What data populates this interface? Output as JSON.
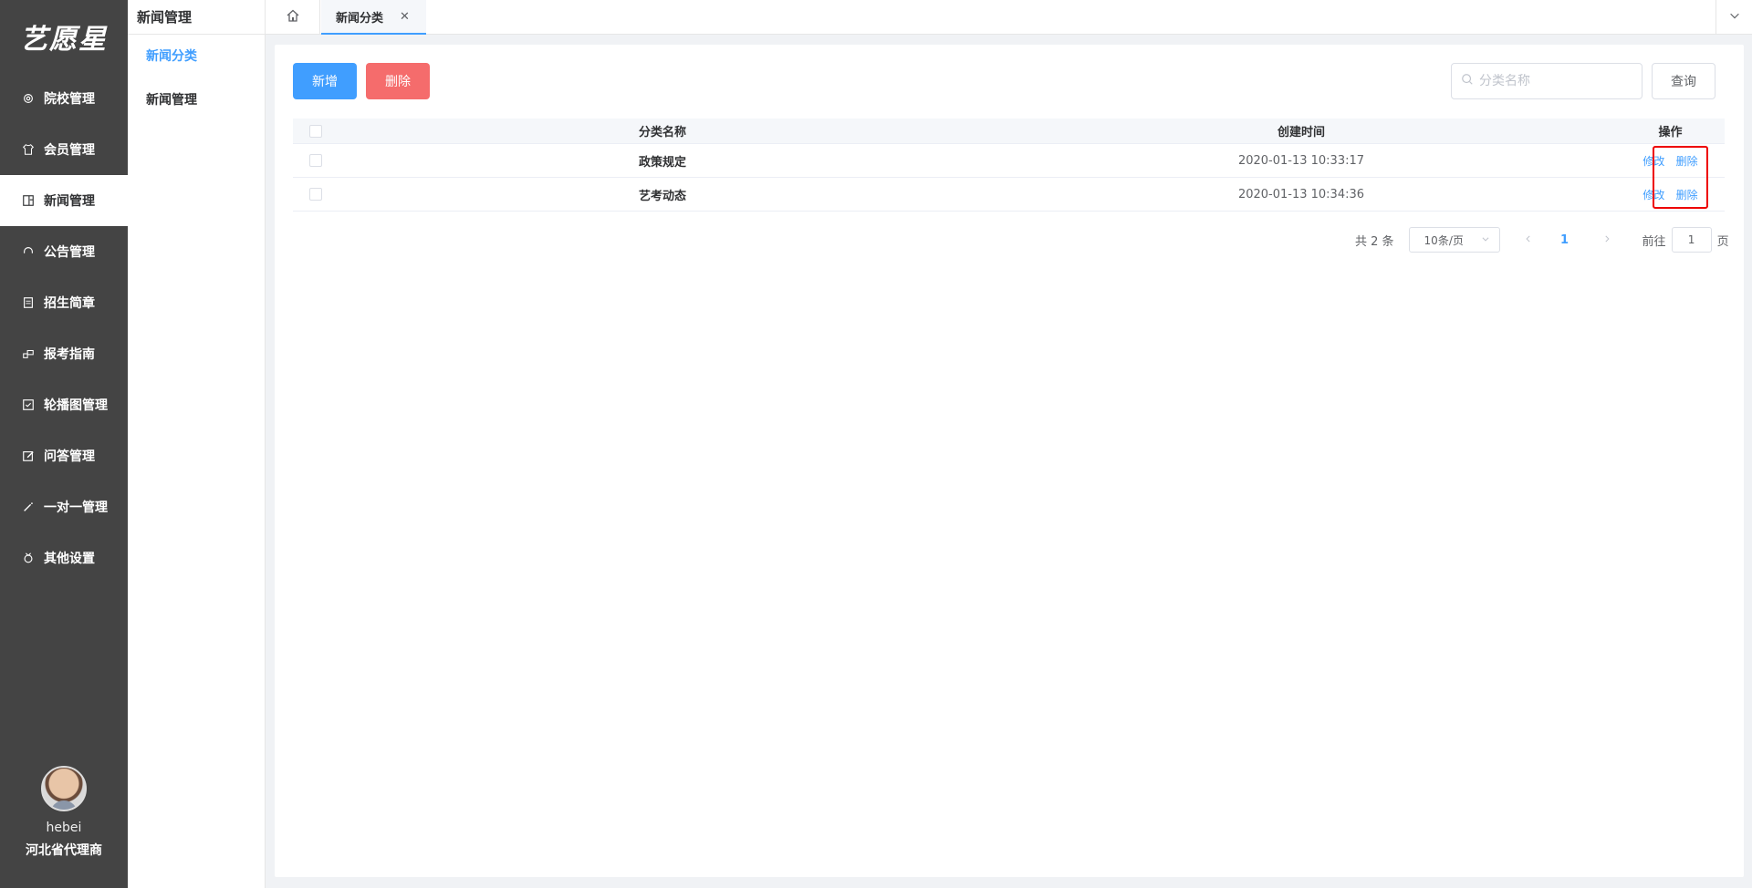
{
  "sidebar": {
    "logo": "艺愿星",
    "items": [
      {
        "label": "院校管理",
        "icon": "gear-icon"
      },
      {
        "label": "会员管理",
        "icon": "shirt-icon"
      },
      {
        "label": "新闻管理",
        "icon": "news-icon"
      },
      {
        "label": "公告管理",
        "icon": "headset-icon"
      },
      {
        "label": "招生简章",
        "icon": "document-icon"
      },
      {
        "label": "报考指南",
        "icon": "guide-icon"
      },
      {
        "label": "轮播图管理",
        "icon": "checkbox-icon"
      },
      {
        "label": "问答管理",
        "icon": "edit-icon"
      },
      {
        "label": "一对一管理",
        "icon": "magic-wand-icon"
      },
      {
        "label": "其他设置",
        "icon": "medal-icon"
      }
    ],
    "active_index": 2,
    "user": {
      "name": "hebei",
      "role": "河北省代理商"
    }
  },
  "subside": {
    "title": "新闻管理",
    "items": [
      {
        "label": "新闻分类"
      },
      {
        "label": "新闻管理"
      }
    ],
    "active_index": 0
  },
  "tabbar": {
    "tabs": [
      {
        "label": "新闻分类"
      }
    ]
  },
  "toolbar": {
    "add_label": "新增",
    "delete_label": "删除",
    "search_placeholder": "分类名称",
    "search_value": "",
    "query_label": "查询"
  },
  "table": {
    "columns": [
      "分类名称",
      "创建时间",
      "操作"
    ],
    "rows": [
      {
        "name": "政策规定",
        "created": "2020-01-13 10:33:17",
        "edit": "修改",
        "delete": "删除"
      },
      {
        "name": "艺考动态",
        "created": "2020-01-13 10:34:36",
        "edit": "修改",
        "delete": "删除"
      }
    ]
  },
  "pagination": {
    "total_label": "共 2 条",
    "page_size": "10条/页",
    "current_page": "1",
    "jump_prefix": "前往",
    "jump_value": "1",
    "jump_suffix": "页"
  },
  "colors": {
    "primary": "#409eff",
    "danger": "#f56c6c",
    "sidebar_bg": "#444444",
    "highlight": "#e00000"
  }
}
